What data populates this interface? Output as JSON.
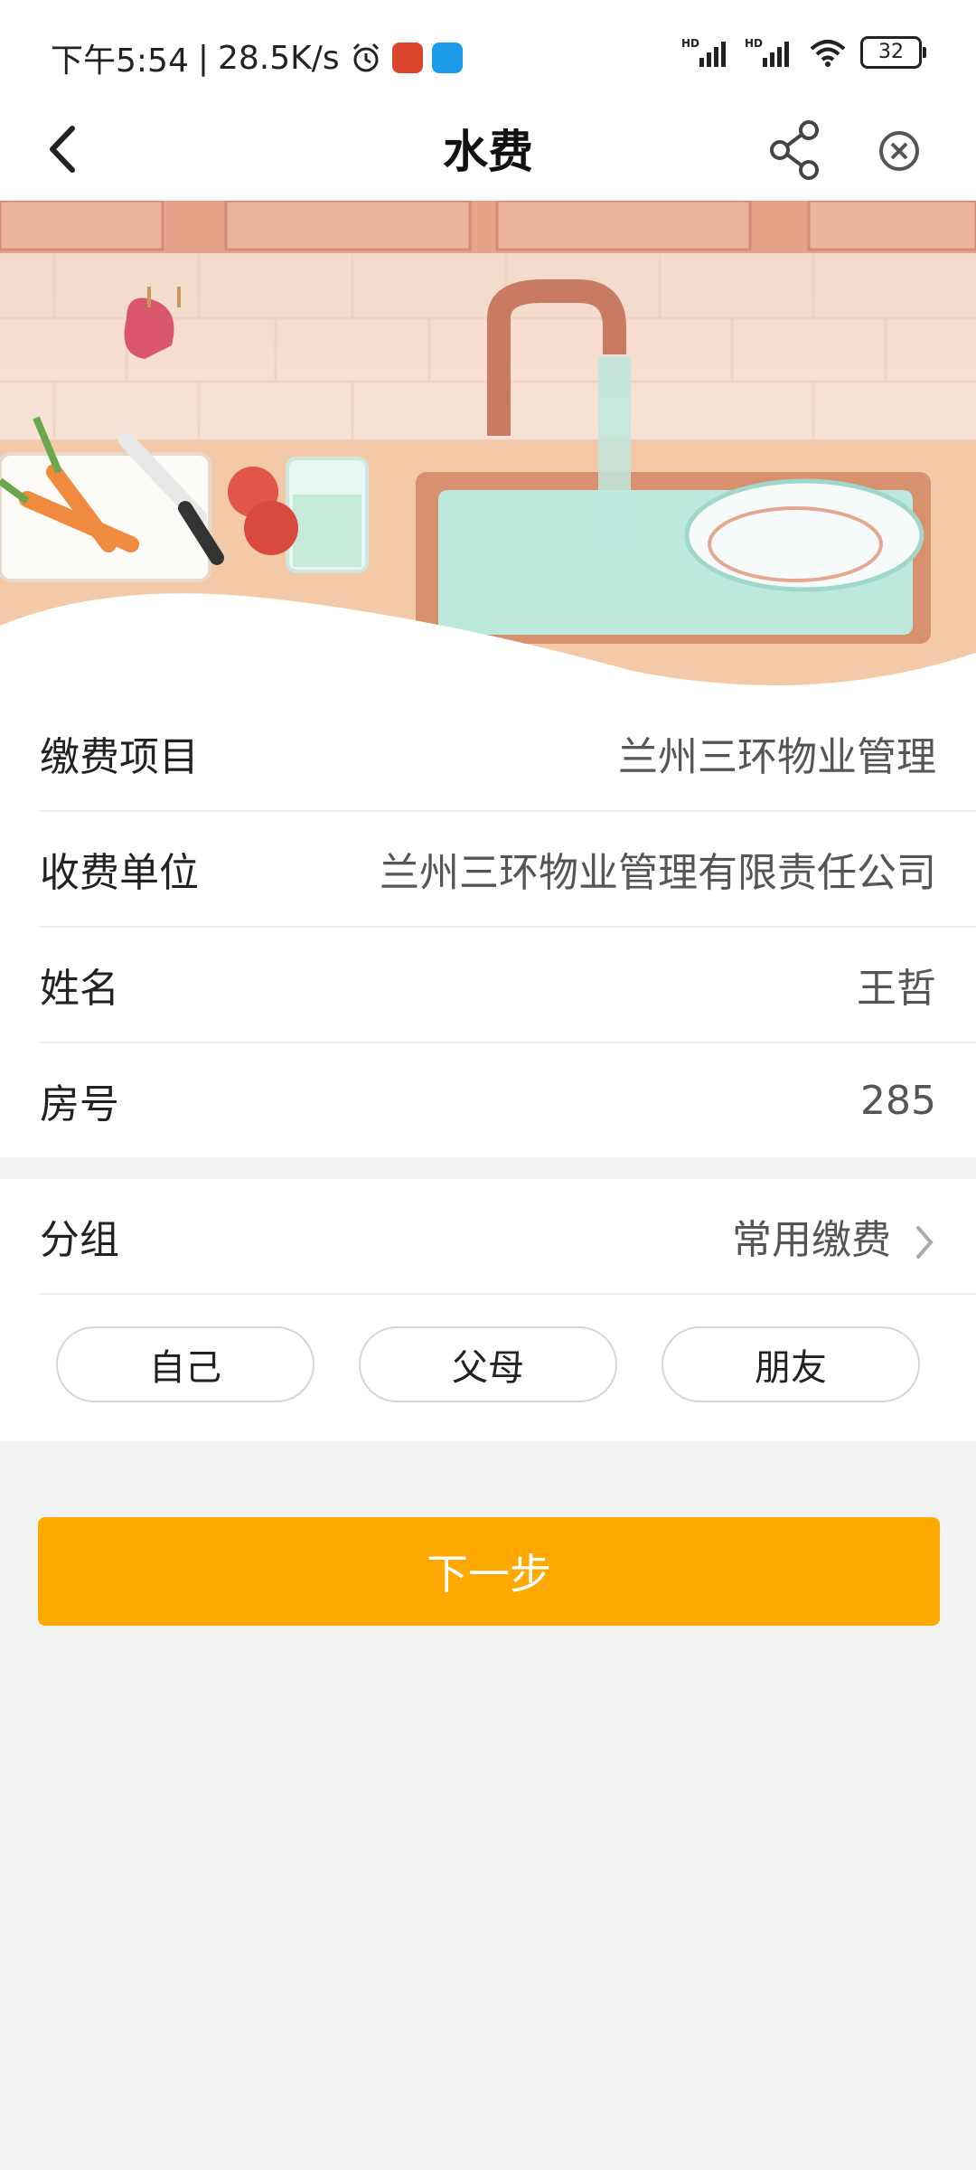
{
  "status_bar": {
    "time": "下午5:54",
    "speed": "28.5K/s",
    "network_1": "HD",
    "network_2": "HD",
    "battery": "32"
  },
  "header": {
    "title": "水费"
  },
  "info_rows": [
    {
      "label": "缴费项目",
      "value": "兰州三环物业管理"
    },
    {
      "label": "收费单位",
      "value": "兰州三环物业管理有限责任公司"
    },
    {
      "label": "姓名",
      "value": "王哲"
    },
    {
      "label": "房号",
      "value": "285"
    }
  ],
  "group": {
    "label": "分组",
    "value": "常用缴费",
    "chips": [
      "自己",
      "父母",
      "朋友"
    ]
  },
  "next_button": "下一步",
  "colors": {
    "accent": "#ffa800",
    "background": "#f2f2f2"
  }
}
